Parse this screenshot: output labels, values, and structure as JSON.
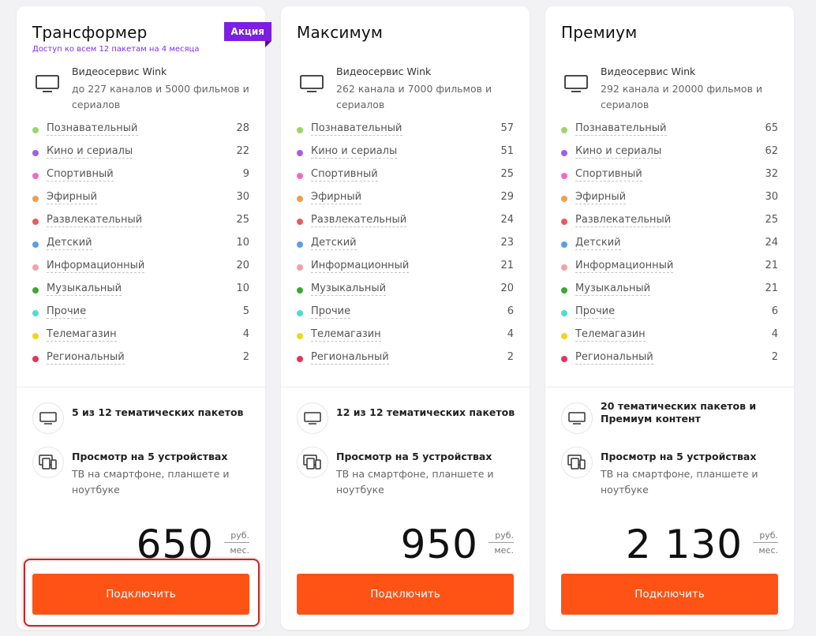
{
  "colors": {
    "accent_orange": "#ff5316",
    "promo_purple": "#7b1fe0",
    "subtitle_purple": "#7b2ff2",
    "highlight_red": "#c1272d"
  },
  "plans": [
    {
      "title": "Трансформер",
      "subtitle": "Доступ ко всем 12 пакетам на 4 месяца",
      "badge": "Акция",
      "service": {
        "name": "Видеосервис Wink",
        "desc": "до 227 каналов и 5000 фильмов и сериалов",
        "icon": "tv-icon"
      },
      "genres": [
        {
          "name": "Познавательный",
          "count": "28"
        },
        {
          "name": "Кино и сериалы",
          "count": "22"
        },
        {
          "name": "Спортивный",
          "count": "9"
        },
        {
          "name": "Эфирный",
          "count": "30"
        },
        {
          "name": "Развлекательный",
          "count": "25"
        },
        {
          "name": "Детский",
          "count": "10"
        },
        {
          "name": "Информационный",
          "count": "20"
        },
        {
          "name": "Музыкальный",
          "count": "10"
        },
        {
          "name": "Прочие",
          "count": "5"
        },
        {
          "name": "Телемагазин",
          "count": "4"
        },
        {
          "name": "Региональный",
          "count": "2"
        }
      ],
      "features": [
        {
          "icon": "tv-icon",
          "title": "5 из 12 тематических пакетов",
          "desc": ""
        },
        {
          "icon": "devices-icon",
          "title": "Просмотр на 5 устройствах",
          "desc": "ТВ на смартфоне, планшете и ноутбуке"
        }
      ],
      "price": {
        "value": "650",
        "currency": "руб.",
        "period": "мес."
      },
      "button": "Подключить"
    },
    {
      "title": "Максимум",
      "subtitle": "",
      "badge": "",
      "service": {
        "name": "Видеосервис Wink",
        "desc": "262 канала и 7000 фильмов и сериалов",
        "icon": "tv-icon"
      },
      "genres": [
        {
          "name": "Познавательный",
          "count": "57"
        },
        {
          "name": "Кино и сериалы",
          "count": "51"
        },
        {
          "name": "Спортивный",
          "count": "25"
        },
        {
          "name": "Эфирный",
          "count": "29"
        },
        {
          "name": "Развлекательный",
          "count": "24"
        },
        {
          "name": "Детский",
          "count": "23"
        },
        {
          "name": "Информационный",
          "count": "21"
        },
        {
          "name": "Музыкальный",
          "count": "20"
        },
        {
          "name": "Прочие",
          "count": "6"
        },
        {
          "name": "Телемагазин",
          "count": "4"
        },
        {
          "name": "Региональный",
          "count": "2"
        }
      ],
      "features": [
        {
          "icon": "tv-icon",
          "title": "12 из 12 тематических пакетов",
          "desc": ""
        },
        {
          "icon": "devices-icon",
          "title": "Просмотр на 5 устройствах",
          "desc": "ТВ на смартфоне, планшете и ноутбуке"
        }
      ],
      "price": {
        "value": "950",
        "currency": "руб.",
        "period": "мес."
      },
      "button": "Подключить"
    },
    {
      "title": "Премиум",
      "subtitle": "",
      "badge": "",
      "service": {
        "name": "Видеосервис Wink",
        "desc": "292 канала и 20000 фильмов и сериалов",
        "icon": "tv-icon"
      },
      "genres": [
        {
          "name": "Познавательный",
          "count": "65"
        },
        {
          "name": "Кино и сериалы",
          "count": "62"
        },
        {
          "name": "Спортивный",
          "count": "32"
        },
        {
          "name": "Эфирный",
          "count": "30"
        },
        {
          "name": "Развлекательный",
          "count": "25"
        },
        {
          "name": "Детский",
          "count": "24"
        },
        {
          "name": "Информационный",
          "count": "21"
        },
        {
          "name": "Музыкальный",
          "count": "21"
        },
        {
          "name": "Прочие",
          "count": "6"
        },
        {
          "name": "Телемагазин",
          "count": "4"
        },
        {
          "name": "Региональный",
          "count": "2"
        }
      ],
      "features": [
        {
          "icon": "tv-icon",
          "title": "20 тематических пакетов и Премиум контент",
          "desc": ""
        },
        {
          "icon": "devices-icon",
          "title": "Просмотр на 5 устройствах",
          "desc": "ТВ на смартфоне, планшете и ноутбуке"
        }
      ],
      "price": {
        "value": "2 130",
        "currency": "руб.",
        "period": "мес."
      },
      "button": "Подключить"
    }
  ],
  "genre_colors": [
    "#9bd66a",
    "#a35fe6",
    "#e86ec8",
    "#eea04a",
    "#ec5a5a",
    "#5b9de8",
    "#f2a3a3",
    "#3fa536",
    "#52dccf",
    "#f6d31c",
    "#e8335a"
  ]
}
